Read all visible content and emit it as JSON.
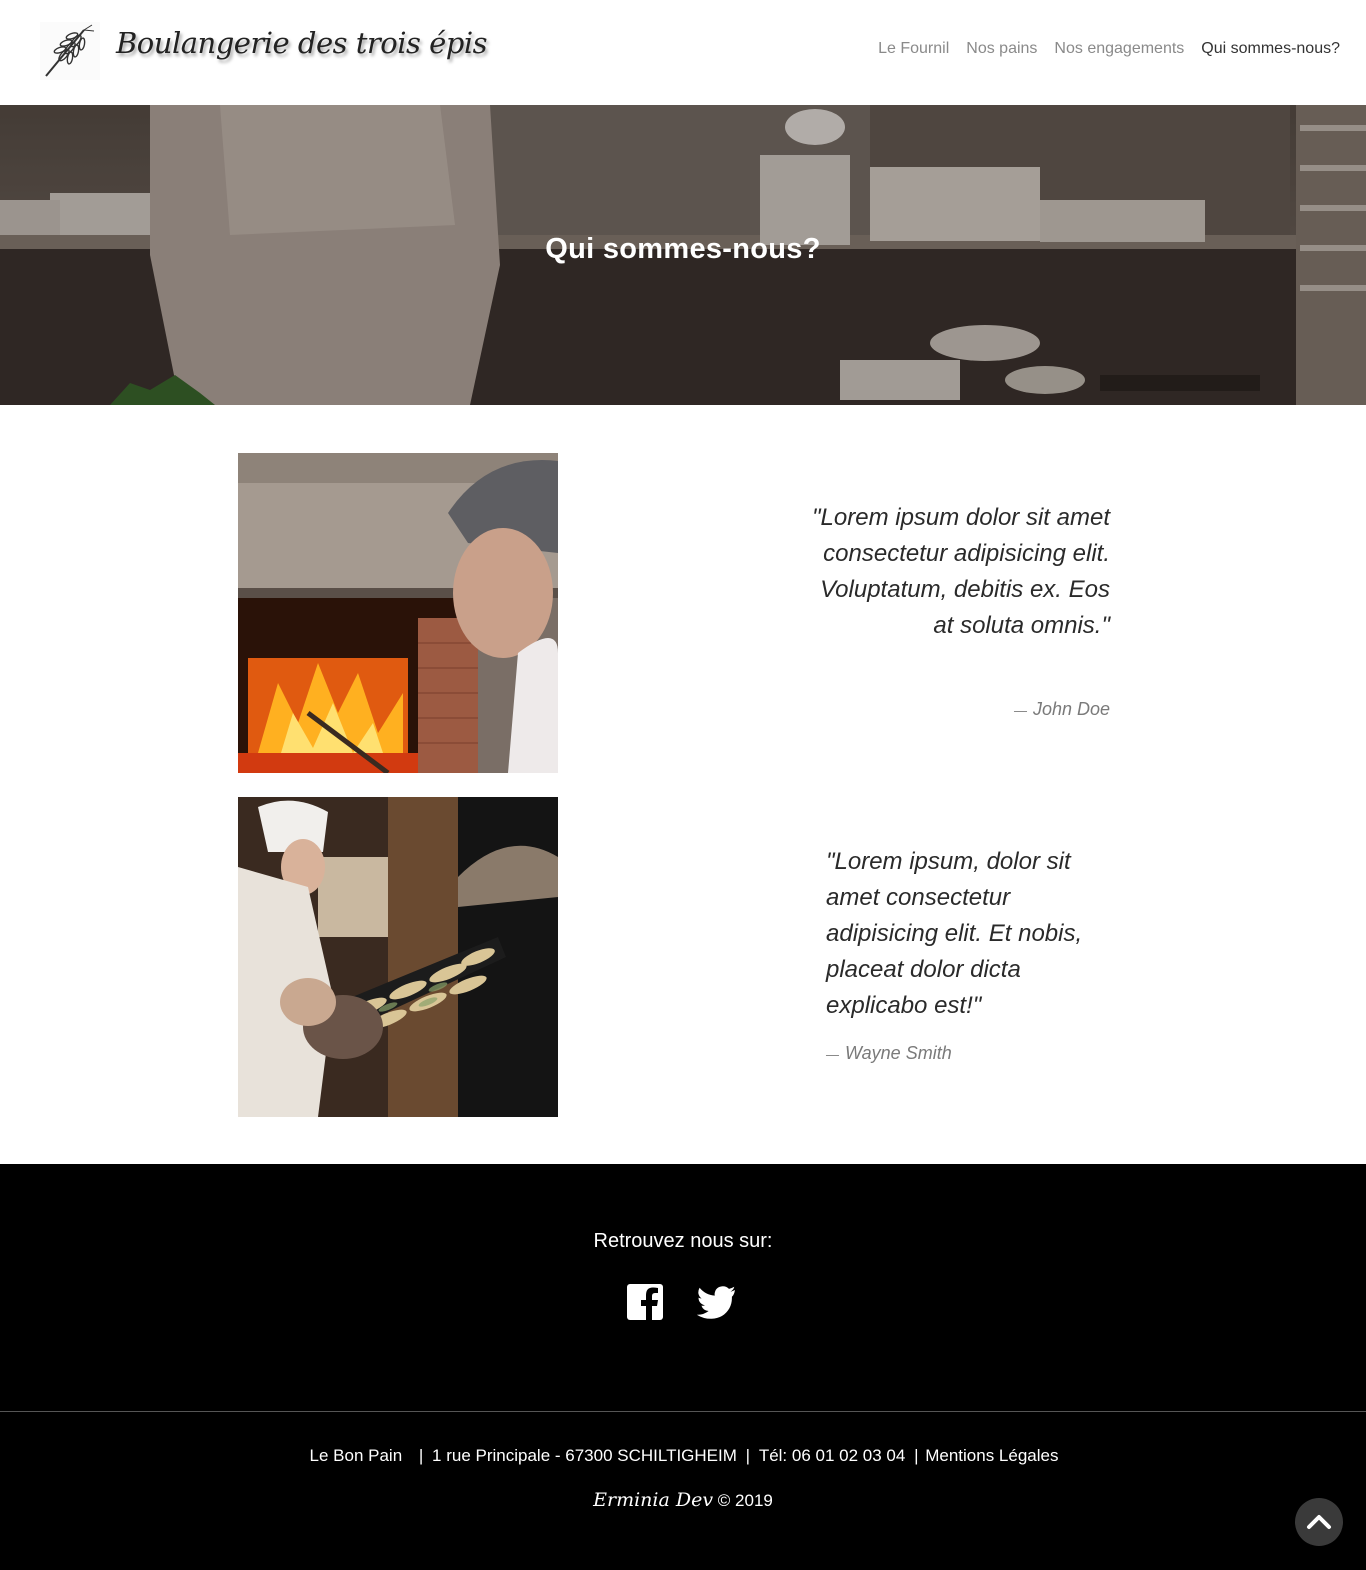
{
  "header": {
    "brand_name": "Boulangerie des trois épis",
    "logo_icon": "wheat-icon",
    "nav": [
      {
        "label": "Le Fournil",
        "active": false
      },
      {
        "label": "Nos pains",
        "active": false
      },
      {
        "label": "Nos engagements",
        "active": false
      },
      {
        "label": "Qui sommes-nous?",
        "active": true
      }
    ]
  },
  "hero": {
    "title": "Qui sommes-nous?"
  },
  "testimonials": [
    {
      "quote": "\"Lorem ipsum dolor sit amet consectetur adipisicing elit. Voluptatum, debitis ex. Eos at soluta omnis.\"",
      "author": "John Doe"
    },
    {
      "quote": "\"Lorem ipsum, dolor sit amet consectetur adipisicing elit. Et nobis, placeat dolor dicta explicabo est!\"",
      "author": "Wayne Smith"
    }
  ],
  "footer": {
    "heading": "Retrouvez nous sur:",
    "social": [
      {
        "name": "facebook-icon"
      },
      {
        "name": "twitter-icon"
      }
    ],
    "company": "Le Bon Pain",
    "address": "1 rue Principale - 67300 SCHILTIGHEIM",
    "phone": "Tél: 06 01 02 03 04",
    "legal": "Mentions Légales",
    "signature": "Erminia Dev",
    "copyright": "© 2019",
    "separator": "|"
  },
  "colors": {
    "nav_inactive": "#8a8a8a",
    "nav_active": "#333333",
    "footer_bg": "#000000",
    "back_to_top_bg": "#3a3a3a"
  }
}
